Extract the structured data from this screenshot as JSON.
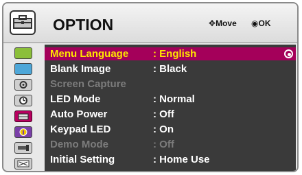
{
  "header": {
    "title": "OPTION",
    "icon": "option-toolbox-icon",
    "hint_move": "Move",
    "hint_ok": "OK"
  },
  "sidebar": {
    "items": [
      {
        "icon": "picture-icon"
      },
      {
        "icon": "audio-icon"
      },
      {
        "icon": "source-icon"
      },
      {
        "icon": "time-icon"
      },
      {
        "icon": "option-icon",
        "active": true
      },
      {
        "icon": "info-icon"
      },
      {
        "icon": "network-icon"
      },
      {
        "icon": "3d-icon"
      }
    ]
  },
  "menu": {
    "items": [
      {
        "label": "Menu Language",
        "value": ": English",
        "selected": true,
        "enabled": true
      },
      {
        "label": "Blank Image",
        "value": ": Black",
        "enabled": true
      },
      {
        "label": "Screen Capture",
        "value": "",
        "enabled": false
      },
      {
        "label": "LED Mode",
        "value": ": Normal",
        "enabled": true
      },
      {
        "label": "Auto Power",
        "value": ": Off",
        "enabled": true
      },
      {
        "label": "Keypad LED",
        "value": ": On",
        "enabled": true
      },
      {
        "label": "Demo Mode",
        "value": ": Off",
        "enabled": false
      },
      {
        "label": "Initial Setting",
        "value": ": Home Use",
        "enabled": true
      }
    ]
  },
  "colors": {
    "selected_row": "#a4005a",
    "selected_text": "#ffe600",
    "menu_bg": "#3a3a3a",
    "disabled_text": "#7c7c7c"
  }
}
